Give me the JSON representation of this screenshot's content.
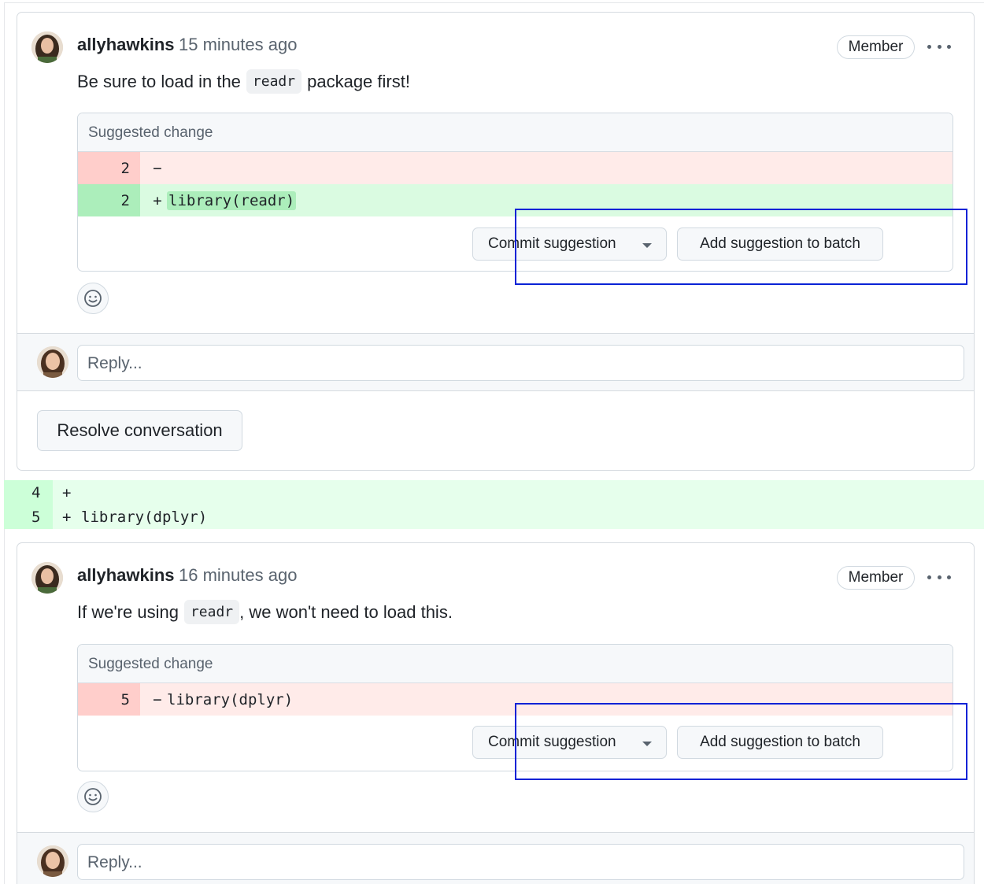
{
  "thread1": {
    "author": "allyhawkins",
    "time": "15 minutes ago",
    "badge": "Member",
    "body_before": "Be sure to load in the",
    "body_code": "readr",
    "body_after": "package first!",
    "suggestion": {
      "header": "Suggested change",
      "rows": [
        {
          "num": "2",
          "sign": "−",
          "code": ""
        },
        {
          "num": "2",
          "sign": "+",
          "code": "library(readr)"
        }
      ]
    },
    "commit_label": "Commit suggestion",
    "batch_label": "Add suggestion to batch",
    "reply_placeholder": "Reply...",
    "resolve_label": "Resolve conversation"
  },
  "diff": [
    {
      "num": "4",
      "sign": "+",
      "code": ""
    },
    {
      "num": "5",
      "sign": "+",
      "code": "library(dplyr)"
    }
  ],
  "thread2": {
    "author": "allyhawkins",
    "time": "16 minutes ago",
    "badge": "Member",
    "body_before": "If we're using",
    "body_code": "readr",
    "body_after": ", we won't need to load this.",
    "suggestion": {
      "header": "Suggested change",
      "rows": [
        {
          "num": "5",
          "sign": "−",
          "code": "library(dplyr)"
        }
      ]
    },
    "commit_label": "Commit suggestion",
    "batch_label": "Add suggestion to batch",
    "reply_placeholder": "Reply..."
  },
  "colors": {
    "highlight": "#0a22d6",
    "deletion": "#ffebe9",
    "addition": "#dafbe1"
  },
  "icons": [
    "kebab-icon",
    "smiley-icon",
    "caret-down-icon",
    "avatar"
  ]
}
